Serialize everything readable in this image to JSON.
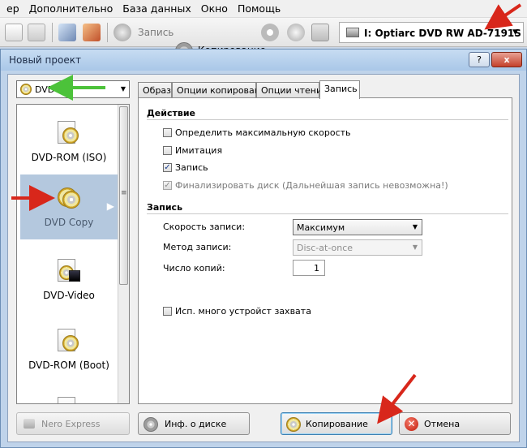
{
  "menu": {
    "items": [
      {
        "label": "ер",
        "underline": ""
      },
      {
        "label": "Дополнительно",
        "underline": "Д"
      },
      {
        "label": "База данных",
        "underline": "Б"
      },
      {
        "label": "Окно",
        "underline": "О"
      },
      {
        "label": "Помощь",
        "underline": "П"
      }
    ]
  },
  "toolbar": {
    "write_label": "Запись",
    "copy_label": "Копирование",
    "drive": "I: Optiarc DVD RW AD-7191S"
  },
  "dialog": {
    "title": "Новый проект",
    "help_btn": "?",
    "close_btn": "x",
    "project_type": "DVD",
    "left_items": [
      {
        "label": "DVD-ROM (ISO)"
      },
      {
        "label": "DVD Copy"
      },
      {
        "label": "DVD-Video"
      },
      {
        "label": "DVD-ROM (Boot)"
      }
    ],
    "tabs": [
      "Образ",
      "Опции копирования",
      "Опции чтения",
      "Запись"
    ],
    "panel": {
      "action_header": "Действие",
      "checks": [
        {
          "label": "Определить максимальную скорость",
          "checked": false,
          "disabled": false
        },
        {
          "label": "Имитация",
          "checked": false,
          "disabled": false
        },
        {
          "label": "Запись",
          "checked": true,
          "disabled": false
        },
        {
          "label": "Финализировать диск (Дальнейшая запись невозможна!)",
          "checked": true,
          "disabled": true
        }
      ],
      "write_header": "Запись",
      "speed_label": "Скорость записи:",
      "speed_value": "Максимум",
      "method_label": "Метод записи:",
      "method_value": "Disc-at-once",
      "copies_label": "Число копий:",
      "copies_value": "1",
      "multi_device": "Исп. много устройст захвата"
    },
    "buttons": {
      "nero_express": "Nero Express",
      "disc_info": "Инф. о диске",
      "copy": "Копирование",
      "cancel": "Отмена"
    }
  },
  "colors": {
    "selection": "#b4c8de",
    "arrow_red": "#d8271b",
    "arrow_green": "#4cc23a"
  }
}
